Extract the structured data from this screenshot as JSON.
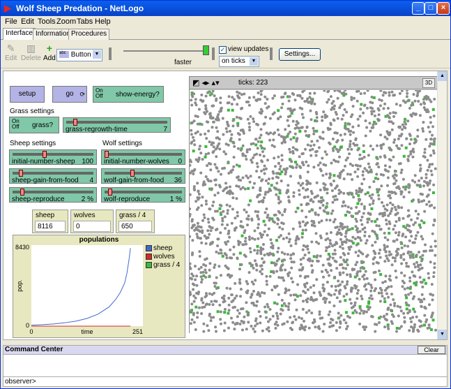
{
  "window": {
    "title": "Wolf Sheep Predation - NetLogo"
  },
  "menu": [
    "File",
    "Edit",
    "Tools",
    "Zoom",
    "Tabs",
    "Help"
  ],
  "tabs": [
    "Interface",
    "Information",
    "Procedures"
  ],
  "toolbar": {
    "edit": "Edit",
    "delete": "Delete",
    "add": "Add",
    "widget_type": "Button",
    "speed_label": "faster",
    "speed": 0.95,
    "view_updates_label": "view updates",
    "view_updates_checked": true,
    "update_mode": "on ticks",
    "settings_label": "Settings..."
  },
  "buttons": {
    "setup": "setup",
    "go": "go"
  },
  "switches": {
    "show_energy": {
      "on": "On",
      "off": "Off",
      "label": "show-energy?"
    },
    "grass": {
      "on": "On",
      "off": "Off",
      "label": "grass?"
    }
  },
  "notes": {
    "grass": "Grass settings",
    "sheep": "Sheep settings",
    "wolf": "Wolf settings"
  },
  "sliders": {
    "grass_regrowth": {
      "name": "grass-regrowth-time",
      "value": "7",
      "fraction": 0.07
    },
    "initial_sheep": {
      "name": "initial-number-sheep",
      "value": "100",
      "fraction": 0.4
    },
    "initial_wolves": {
      "name": "initial-number-wolves",
      "value": "0",
      "fraction": 0.0
    },
    "sheep_gain": {
      "name": "sheep-gain-from-food",
      "value": "4",
      "fraction": 0.08
    },
    "wolf_gain": {
      "name": "wolf-gain-from-food",
      "value": "36",
      "fraction": 0.36
    },
    "sheep_reproduce": {
      "name": "sheep-reproduce",
      "value": "2 %",
      "fraction": 0.1
    },
    "wolf_reproduce": {
      "name": "wolf-reproduce",
      "value": "1 %",
      "fraction": 0.05
    }
  },
  "monitors": {
    "sheep": {
      "label": "sheep",
      "value": "8116"
    },
    "wolves": {
      "label": "wolves",
      "value": "0"
    },
    "grass": {
      "label": "grass / 4",
      "value": "650"
    }
  },
  "view": {
    "ticks_label": "ticks: 223",
    "three_d": "3D"
  },
  "colors": {
    "sheep": "#4169c8",
    "wolves": "#d42a2a",
    "grass": "#3cb83c"
  },
  "chart_data": {
    "type": "line",
    "title": "populations",
    "xlabel": "time",
    "ylabel": "pop.",
    "xlim": [
      0,
      251
    ],
    "ylim": [
      0,
      8430
    ],
    "x_tick_labels": [
      "0",
      "251"
    ],
    "y_tick_labels": [
      "0",
      "8430"
    ],
    "series": [
      {
        "name": "sheep",
        "x": [
          0,
          25,
          50,
          75,
          100,
          125,
          150,
          175,
          190,
          200,
          210,
          215,
          220,
          223
        ],
        "values": [
          100,
          150,
          230,
          350,
          520,
          800,
          1250,
          2000,
          2800,
          3500,
          4500,
          5500,
          7000,
          8116
        ]
      },
      {
        "name": "wolves",
        "x": [
          0,
          223
        ],
        "values": [
          0,
          0
        ]
      },
      {
        "name": "grass / 4",
        "x": [
          0,
          223
        ],
        "values": [
          650,
          650
        ]
      }
    ],
    "legend": "right"
  },
  "command_center": {
    "title": "Command Center",
    "clear": "Clear",
    "prompt": "observer>"
  }
}
